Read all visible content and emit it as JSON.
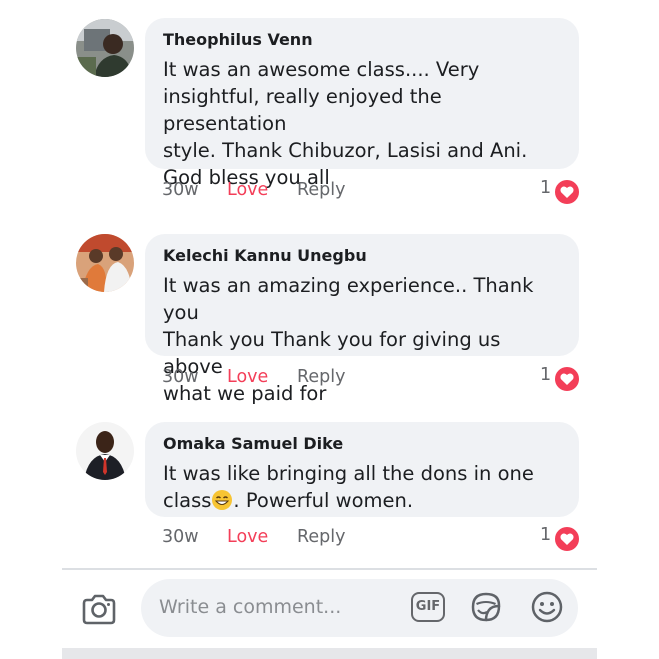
{
  "comments": [
    {
      "author": "Theophilus Venn",
      "lines": [
        "It was an awesome class.... Very",
        "insightful, really enjoyed the presentation",
        "style. Thank Chibuzor, Lasisi and Ani.",
        "God bless you all"
      ],
      "time": "30w",
      "love": "Love",
      "reply": "Reply",
      "reaction_count": "1",
      "reaction_icon": "heart-icon"
    },
    {
      "author": "Kelechi Kannu Unegbu",
      "lines": [
        "It was an amazing experience.. Thank you",
        "Thank you Thank you for giving us above",
        "what we paid for"
      ],
      "time": "30w",
      "love": "Love",
      "reply": "Reply",
      "reaction_count": "1",
      "reaction_icon": "heart-icon"
    },
    {
      "author": "Omaka Samuel Dike",
      "lines": [
        "It was like bringing all the dons in one",
        "class",
        ". Powerful women."
      ],
      "emoji": "grinning-face-emoji",
      "time": "30w",
      "love": "Love",
      "reply": "Reply",
      "reaction_count": "1",
      "reaction_icon": "heart-icon"
    }
  ],
  "composer": {
    "placeholder": "Write a comment...",
    "gif_label": "GIF",
    "icons": [
      "camera-icon",
      "gif-icon",
      "sticker-icon",
      "emoji-icon"
    ]
  },
  "colors": {
    "love": "#f33e58",
    "bubble": "#f0f2f5",
    "meta_text": "#65676b",
    "placeholder": "#8a8d91"
  }
}
